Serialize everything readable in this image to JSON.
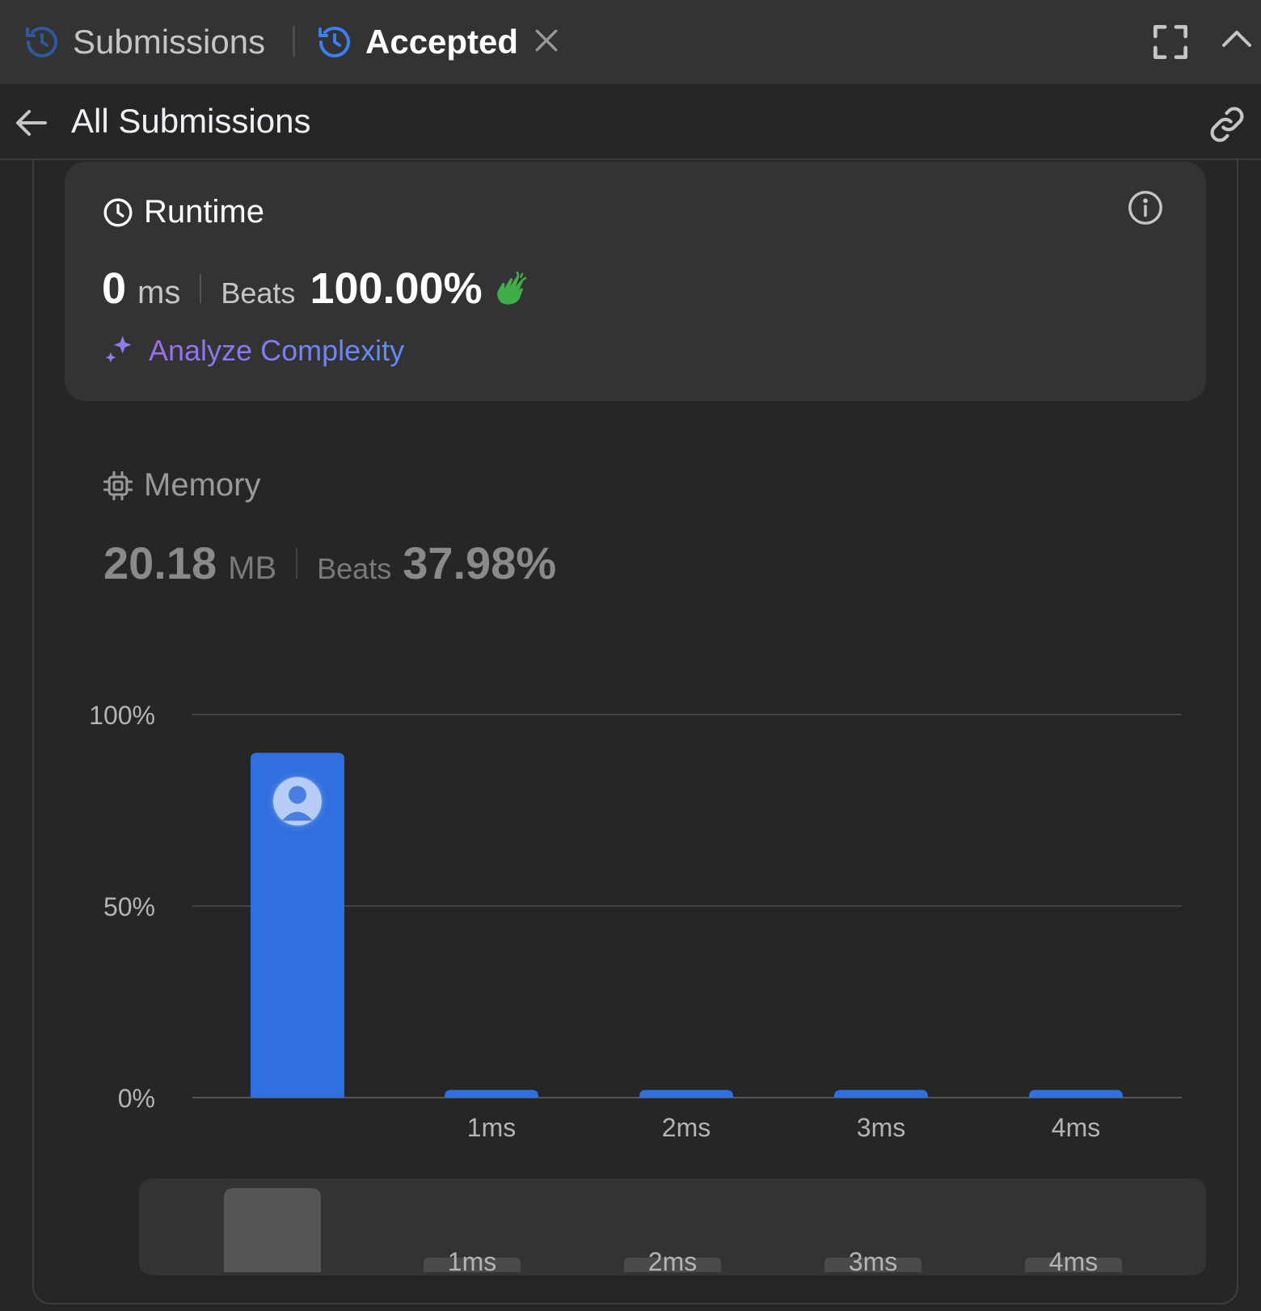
{
  "tabs": [
    {
      "label": "Submissions",
      "icon": "history-icon"
    },
    {
      "label": "Accepted",
      "icon": "history-icon",
      "closable": true
    }
  ],
  "subheader": {
    "title": "All Submissions",
    "back_icon": "arrow-left-icon",
    "link_icon": "link-icon"
  },
  "runtime": {
    "title": "Runtime",
    "value": "0",
    "unit": "ms",
    "beats_label": "Beats",
    "beats_value": "100.00%",
    "analyze_label": "Analyze Complexity"
  },
  "memory": {
    "title": "Memory",
    "value": "20.18",
    "unit": "MB",
    "beats_label": "Beats",
    "beats_value": "37.98%"
  },
  "colors": {
    "accent": "#2f6fe0",
    "clap": "#3fae49",
    "analyze_from": "#a26cf0",
    "analyze_to": "#5b8ff9"
  },
  "chart_data": {
    "type": "bar",
    "title": "",
    "xlabel": "",
    "ylabel": "",
    "categories": [
      "0ms",
      "1ms",
      "2ms",
      "3ms",
      "4ms"
    ],
    "x_tick_labels": [
      "",
      "1ms",
      "2ms",
      "3ms",
      "4ms"
    ],
    "values": [
      90,
      2,
      2,
      2,
      2
    ],
    "highlight_index": 0,
    "ylim": [
      0,
      100
    ],
    "y_ticks": [
      {
        "value": 100,
        "label": "100%"
      },
      {
        "value": 50,
        "label": "50%"
      },
      {
        "value": 0,
        "label": "0%"
      }
    ],
    "grid": true,
    "bar_color": "#2f6fe0",
    "overview_tick_labels": [
      "1ms",
      "2ms",
      "3ms",
      "4ms"
    ]
  }
}
